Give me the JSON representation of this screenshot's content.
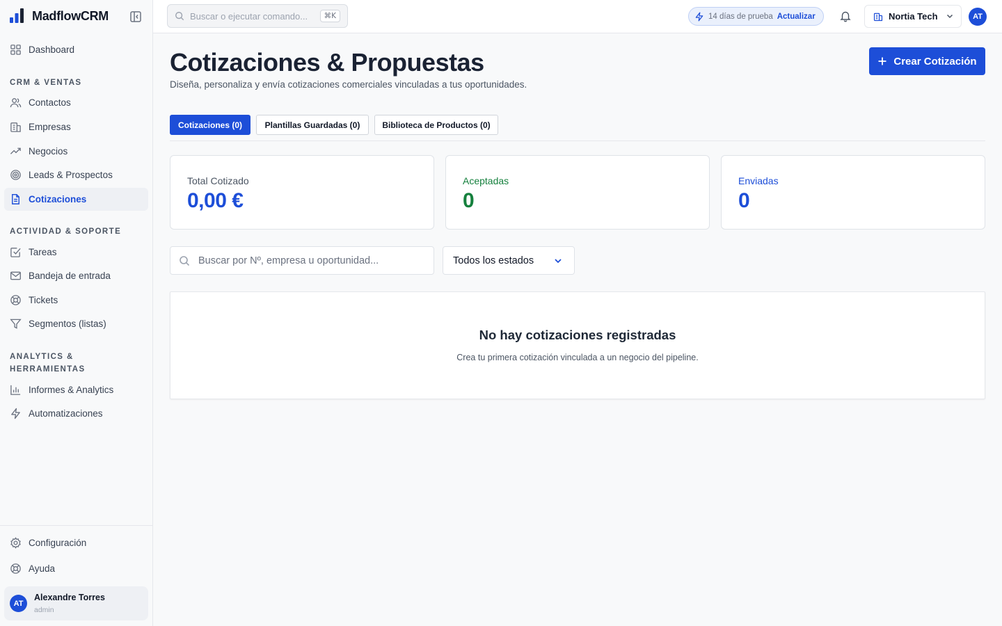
{
  "app": {
    "name": "MadflowCRM"
  },
  "colors": {
    "primary": "#1d4ed8",
    "success": "#15803d"
  },
  "sidebar": {
    "dashboard": "Dashboard",
    "sections": {
      "crm": "CRM & VENTAS",
      "activity": "ACTIVIDAD & SOPORTE",
      "analytics": "ANALYTICS & HERRAMIENTAS"
    },
    "items": {
      "contacts": "Contactos",
      "companies": "Empresas",
      "deals": "Negocios",
      "leads": "Leads & Prospectos",
      "quotes": "Cotizaciones",
      "tasks": "Tareas",
      "inbox": "Bandeja de entrada",
      "tickets": "Tickets",
      "segments": "Segmentos (listas)",
      "reports": "Informes & Analytics",
      "automations": "Automatizaciones"
    },
    "settings": "Configuración",
    "help": "Ayuda",
    "user": {
      "name": "Alexandre Torres",
      "role": "admin",
      "initials": "AT"
    }
  },
  "topbar": {
    "search_placeholder": "Buscar o ejecutar comando...",
    "shortcut": "⌘K",
    "trial_text": "14 días de prueba",
    "upgrade_label": "Actualizar",
    "workspace": "Nortia Tech",
    "user_initials": "AT"
  },
  "page": {
    "title": "Cotizaciones & Propuestas",
    "subtitle": "Diseña, personaliza y envía cotizaciones comerciales vinculadas a tus oportunidades.",
    "create_button": "Crear Cotización"
  },
  "tabs": [
    {
      "label": "Cotizaciones (0)",
      "active": true
    },
    {
      "label": "Plantillas Guardadas (0)",
      "active": false
    },
    {
      "label": "Biblioteca de Productos (0)",
      "active": false
    }
  ],
  "stats": [
    {
      "label": "Total Cotizado",
      "value": "0,00 €"
    },
    {
      "label": "Aceptadas",
      "value": "0"
    },
    {
      "label": "Enviadas",
      "value": "0"
    }
  ],
  "filters": {
    "search_placeholder": "Buscar por Nº, empresa u oportunidad...",
    "status_selected": "Todos los estados"
  },
  "empty_state": {
    "title": "No hay cotizaciones registradas",
    "subtitle": "Crea tu primera cotización vinculada a un negocio del pipeline."
  }
}
